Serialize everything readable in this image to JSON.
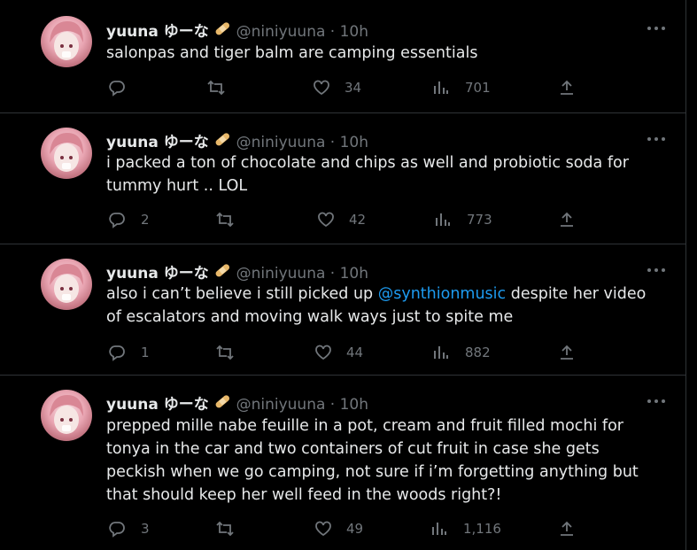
{
  "tweets": [
    {
      "name": "yuuna ゆーな",
      "handle": "@niniyuuna · 10h",
      "text": "salonpas and tiger balm are camping essentials",
      "replies": "",
      "reposts": "",
      "likes": "34",
      "views": "701"
    },
    {
      "name": "yuuna ゆーな",
      "handle": "@niniyuuna · 10h",
      "text": "i packed a ton of chocolate and chips as well and probiotic soda for tummy hurt .. LOL",
      "replies": "2",
      "reposts": "",
      "likes": "42",
      "views": "773"
    },
    {
      "name": "yuuna ゆーな",
      "handle": "@niniyuuna · 10h",
      "text_before": "also i can’t believe i still picked up ",
      "mention": "@synthionmusic",
      "text_after": " despite her video of escalators and moving walk ways just to spite me",
      "replies": "1",
      "reposts": "",
      "likes": "44",
      "views": "882"
    },
    {
      "name": "yuuna ゆーな",
      "handle": "@niniyuuna · 10h",
      "text": "prepped mille nabe feuille in a pot, cream and fruit filled mochi for tonya in the car and two containers of cut fruit in case she gets peckish when we go camping, not sure if i’m forgetting anything but that should keep her well feed in the woods right?!",
      "replies": "3",
      "reposts": "",
      "likes": "49",
      "views": "1,116"
    }
  ],
  "icons": {
    "reply": "speech-bubble-icon",
    "repost": "repost-arrows-icon",
    "like": "heart-icon",
    "views": "bar-chart-icon",
    "share": "share-upload-icon",
    "more": "more-dots-icon",
    "badge": "bandage-emoji"
  },
  "colors": {
    "background": "#000000",
    "text": "#e7e9ea",
    "secondary": "#71767b",
    "link": "#1d9bf0",
    "divider": "#2f3336"
  }
}
